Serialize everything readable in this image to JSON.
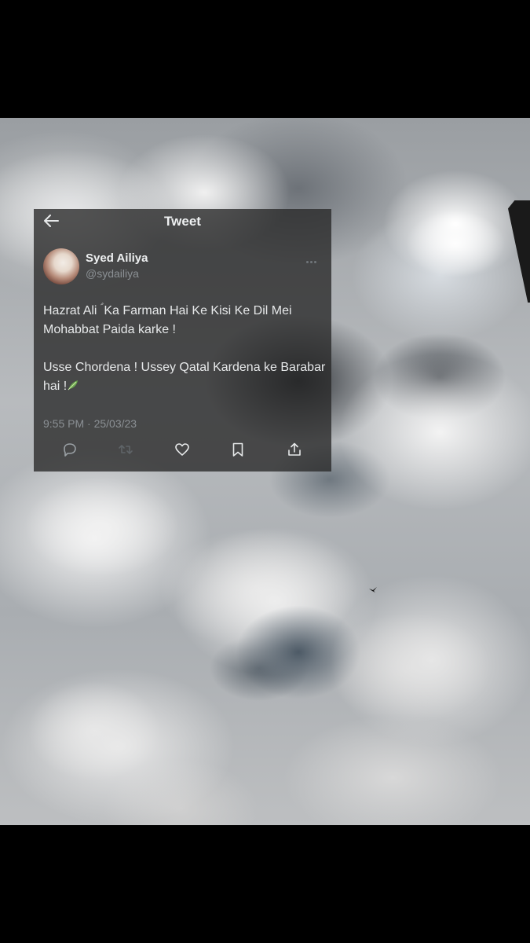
{
  "header": {
    "title": "Tweet"
  },
  "user": {
    "name": "Syed Ailiya",
    "handle": "@sydailiya"
  },
  "tweet": {
    "line1": "Hazrat Ali ؑ Ka Farman Hai Ke Kisi Ke Dil Mei Mohabbat Paida karke !",
    "line2": "Usse Chordena ! Ussey Qatal Kardena ke Barabar hai !",
    "timestamp": "9:55 PM · 25/03/23"
  },
  "icons": {
    "back": "arrow-left-icon",
    "more": "more-dots-icon",
    "reply": "reply-icon",
    "retweet": "retweet-icon",
    "like": "heart-icon",
    "bookmark": "bookmark-icon",
    "share": "share-icon",
    "emoji": "leaf-emoji-icon"
  },
  "colors": {
    "card_bg": "#282828",
    "text": "#e7e9ea",
    "muted": "#8b9094"
  }
}
